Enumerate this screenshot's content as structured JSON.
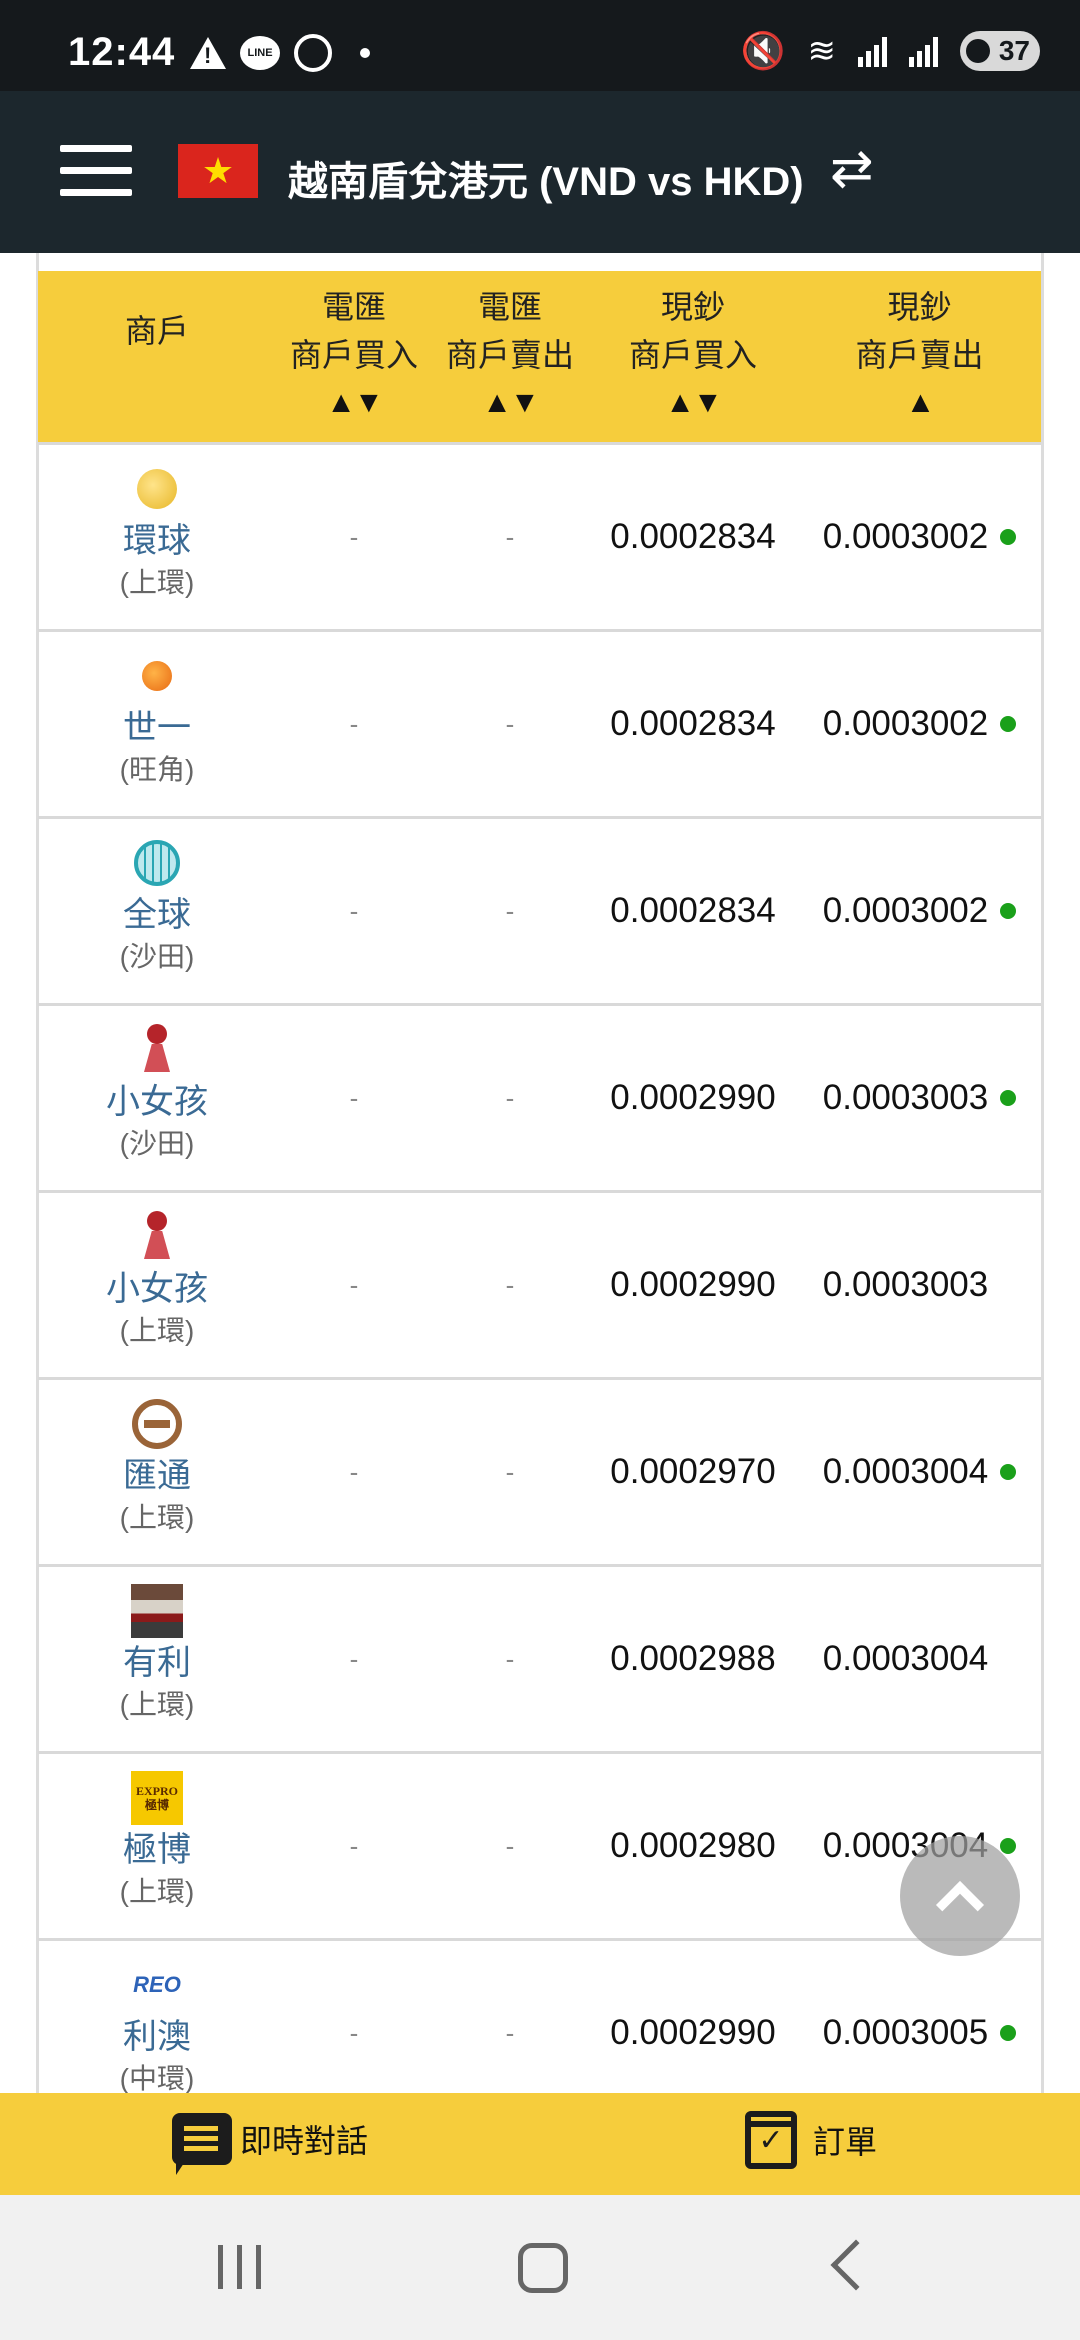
{
  "status_bar": {
    "time": "12:44",
    "line_icon_text": "LINE",
    "battery": "37",
    "icons": [
      "warning-icon",
      "line-icon",
      "whatsapp-icon",
      "notification-dot",
      "mute-icon",
      "wifi-icon",
      "signal-icon",
      "battery-icon"
    ]
  },
  "header": {
    "title": "越南盾兌港元 (VND vs HKD)",
    "flag_icon": "vietnam-flag-icon",
    "menu_icon": "hamburger-menu-icon",
    "swap_icon": "swap-arrows-icon",
    "flag_star": "★",
    "swap_glyph": "⇄"
  },
  "table": {
    "headers": {
      "merchant": "商戶",
      "tt_buy": [
        "電匯",
        "商戶買入"
      ],
      "tt_sell": [
        "電匯",
        "商戶賣出"
      ],
      "cash_buy": [
        "現鈔",
        "商戶買入"
      ],
      "cash_sell": [
        "現鈔",
        "商戶賣出"
      ],
      "sort_both": "▲▼",
      "sort_up": "▲"
    },
    "rows": [
      {
        "name": "環球",
        "location": "(上環)",
        "tt_buy": "-",
        "tt_sell": "-",
        "cash_buy": "0.0002834",
        "cash_sell": "0.0003002",
        "online": true,
        "logo": "gold-coin-logo"
      },
      {
        "name": "世一",
        "location": "(旺角)",
        "tt_buy": "-",
        "tt_sell": "-",
        "cash_buy": "0.0002834",
        "cash_sell": "0.0003002",
        "online": true,
        "logo": "orange-ball-logo"
      },
      {
        "name": "全球",
        "location": "(沙田)",
        "tt_buy": "-",
        "tt_sell": "-",
        "cash_buy": "0.0002834",
        "cash_sell": "0.0003002",
        "online": true,
        "logo": "globe-logo"
      },
      {
        "name": "小女孩",
        "location": "(沙田)",
        "tt_buy": "-",
        "tt_sell": "-",
        "cash_buy": "0.0002990",
        "cash_sell": "0.0003003",
        "online": true,
        "logo": "girl-logo"
      },
      {
        "name": "小女孩",
        "location": "(上環)",
        "tt_buy": "-",
        "tt_sell": "-",
        "cash_buy": "0.0002990",
        "cash_sell": "0.0003003",
        "online": false,
        "logo": "girl-logo"
      },
      {
        "name": "匯通",
        "location": "(上環)",
        "tt_buy": "-",
        "tt_sell": "-",
        "cash_buy": "0.0002970",
        "cash_sell": "0.0003004",
        "online": true,
        "logo": "ring-logo"
      },
      {
        "name": "有利",
        "location": "(上環)",
        "tt_buy": "-",
        "tt_sell": "-",
        "cash_buy": "0.0002988",
        "cash_sell": "0.0003004",
        "online": false,
        "logo": "shopfront-logo"
      },
      {
        "name": "極博",
        "location": "(上環)",
        "tt_buy": "-",
        "tt_sell": "-",
        "cash_buy": "0.0002980",
        "cash_sell": "0.0003004",
        "online": true,
        "logo": "expro-logo",
        "logo_text": [
          "EXPRO",
          "極博"
        ]
      },
      {
        "name": "利澳",
        "location": "(中環)",
        "tt_buy": "-",
        "tt_sell": "-",
        "cash_buy": "0.0002990",
        "cash_sell": "0.0003005",
        "online": true,
        "logo": "reo-logo",
        "logo_text": [
          "REO"
        ]
      }
    ]
  },
  "fab": {
    "icon": "chevron-up-icon"
  },
  "bottom_bar": {
    "chat_label": "即時對話",
    "chat_icon": "chat-bubble-icon",
    "order_label": "訂單",
    "order_icon": "calendar-check-icon",
    "check_glyph": "✓"
  },
  "nav_bar": {
    "icons": [
      "recents-icon",
      "home-icon",
      "back-icon"
    ]
  },
  "colors": {
    "header_bg": "#1c272d",
    "accent_yellow": "#f6cd3c",
    "merchant_link": "#3a6a94",
    "online_green": "#1aa01a"
  }
}
